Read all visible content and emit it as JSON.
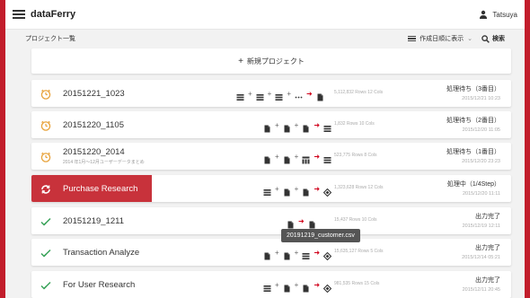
{
  "app": {
    "title": "dataFerry",
    "user": "Tatsuya"
  },
  "subbar": {
    "breadcrumb": "プロジェクト一覧",
    "sort_label": "作成日順に表示",
    "sort_chevron": "⌄",
    "search_label": "検索"
  },
  "new_project": {
    "plus": "+",
    "label": "新規プロジェクト"
  },
  "projects": [
    {
      "name": "20151221_1023",
      "subtitle": "",
      "stats_rows": "5,112,832",
      "rows_word": "Rows",
      "cols": "12",
      "cols_word": "Cols",
      "status": "処理待ち（3番目）",
      "time": "2015/12/21 10:23",
      "icon": "clock-icon"
    },
    {
      "name": "20151220_1105",
      "subtitle": "",
      "stats_rows": "1,832",
      "rows_word": "Rows",
      "cols": "10",
      "cols_word": "Cols",
      "status": "処理待ち（2番目）",
      "time": "2015/12/20 11:05",
      "icon": "clock-icon"
    },
    {
      "name": "20151220_2014",
      "subtitle": "2014 年1月〜12月ユーザーデータまとめ",
      "stats_rows": "523,775",
      "rows_word": "Rows",
      "cols": "8",
      "cols_word": "Cols",
      "status": "処理待ち（1番目）",
      "time": "2015/12/20 23:23",
      "icon": "clock-icon"
    },
    {
      "name": "Purchase Research",
      "subtitle": "",
      "stats_rows": "1,323,628",
      "rows_word": "Rows",
      "cols": "12",
      "cols_word": "Cols",
      "status": "処理中（1/4Step）",
      "time": "2015/12/20 11:11",
      "icon": "processing-icon"
    },
    {
      "name": "20151219_1211",
      "subtitle": "",
      "stats_rows": "15,437",
      "rows_word": "Rows",
      "cols": "10",
      "cols_word": "Cols",
      "status": "出力完了",
      "time": "2015/12/19 12:11",
      "icon": "check-icon"
    },
    {
      "name": "Transaction Analyze",
      "subtitle": "",
      "stats_rows": "15,635,127",
      "rows_word": "Rows",
      "cols": "5",
      "cols_word": "Cols",
      "status": "出力完了",
      "time": "2015/12/14 05:21",
      "icon": "check-icon"
    },
    {
      "name": "For User Research",
      "subtitle": "",
      "stats_rows": "981,535",
      "rows_word": "Rows",
      "cols": "15",
      "cols_word": "Cols",
      "status": "出力完了",
      "time": "2015/12/11 20:45",
      "icon": "check-icon"
    }
  ],
  "tooltip": "20191219_customer.csv",
  "colors": {
    "accent": "#c21d2b",
    "arrow": "#d0021b",
    "done": "#3aa35a",
    "waiting": "#e8a33c"
  }
}
